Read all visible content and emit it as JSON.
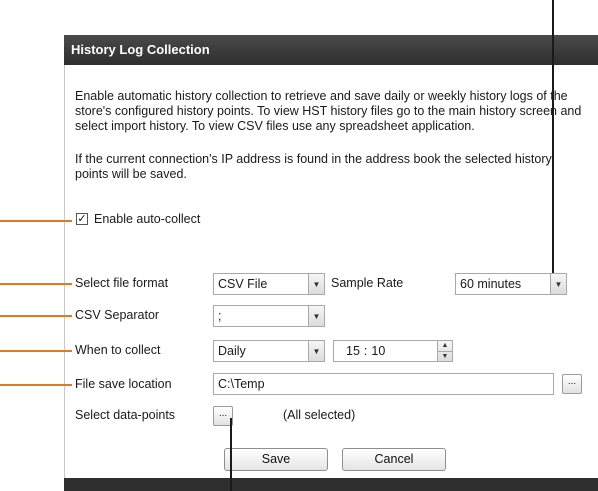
{
  "dialog": {
    "title": "History Log Collection",
    "description_1": "Enable automatic history collection to retrieve and save daily or weekly history logs of the store's configured history points. To view HST history files go to the main history screen and select import history. To view CSV files use any spreadsheet application.",
    "description_2": "If the current connection's IP address is found in the address book the selected history points will be saved."
  },
  "auto_collect": {
    "label": "Enable auto-collect",
    "checked": true,
    "check_glyph": "✓"
  },
  "file_format": {
    "label": "Select file format",
    "value": "CSV File"
  },
  "sample_rate": {
    "label": "Sample Rate",
    "value": "60 minutes"
  },
  "csv_separator": {
    "label": "CSV Separator",
    "value": ";"
  },
  "when_to_collect": {
    "label": "When to collect",
    "value": "Daily",
    "hour": "15",
    "colon": ":",
    "minute": "10"
  },
  "file_save_location": {
    "label": "File save location",
    "value": "C:\\Temp",
    "browse_label": "..."
  },
  "data_points": {
    "label": "Select data-points",
    "button_label": "...",
    "status": "(All selected)"
  },
  "buttons": {
    "save": "Save",
    "cancel": "Cancel"
  },
  "icons": {
    "dropdown": "▼",
    "spin_up": "▲",
    "spin_down": "▼"
  },
  "colors": {
    "callout_line": "#e07a22",
    "titlebar": "#3a3a3a"
  }
}
